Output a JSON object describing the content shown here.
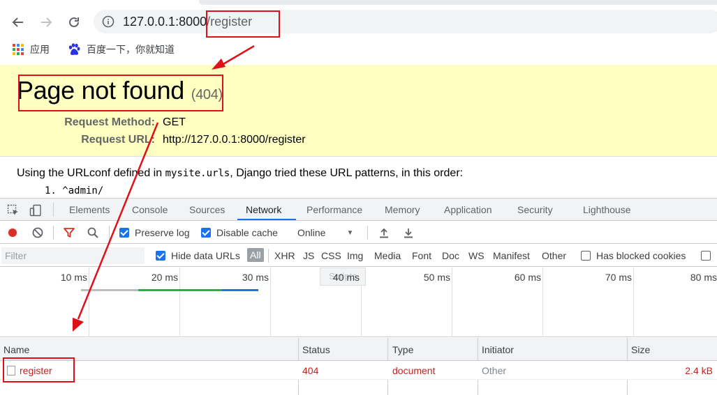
{
  "browser": {
    "url_host": "127.0.0.1:8000",
    "url_path": "/register",
    "bookmarks": [
      {
        "label": "应用",
        "icon": "apps-grid-icon"
      },
      {
        "label": "百度一下，你就知道",
        "icon": "baidu-paw-icon"
      }
    ]
  },
  "page": {
    "title": "Page not found",
    "status_code": "(404)",
    "request_method_label": "Request Method:",
    "request_method": "GET",
    "request_url_label": "Request URL:",
    "request_url": "http://127.0.0.1:8000/register",
    "info_before": "Using the URLconf defined in ",
    "info_module": "mysite.urls",
    "info_after": ", Django tried these URL patterns, in this order:",
    "patterns": [
      "1. ^admin/"
    ]
  },
  "devtools": {
    "tabs": [
      "Elements",
      "Console",
      "Sources",
      "Network",
      "Performance",
      "Memory",
      "Application",
      "Security",
      "Lighthouse"
    ],
    "active_tab": "Network",
    "controls": {
      "preserve_log": "Preserve log",
      "disable_cache": "Disable cache",
      "throttling": "Online"
    },
    "filter": {
      "placeholder": "Filter",
      "hide_data_urls": "Hide data URLs",
      "types": [
        "All",
        "XHR",
        "JS",
        "CSS",
        "Img",
        "Media",
        "Font",
        "Doc",
        "WS",
        "Manifest",
        "Other"
      ],
      "has_blocked_cookies": "Has blocked cookies"
    },
    "timeline": {
      "ticks": [
        "10 ms",
        "20 ms",
        "30 ms",
        "40 ms",
        "50 ms",
        "60 ms",
        "70 ms",
        "80 ms"
      ],
      "tooltip": "Scripts"
    },
    "table": {
      "columns": [
        "Name",
        "Status",
        "Type",
        "Initiator",
        "Size"
      ],
      "rows": [
        {
          "name": "register",
          "status": "404",
          "type": "document",
          "initiator": "Other",
          "size": "2.4 kB"
        }
      ]
    }
  },
  "colors": {
    "annotation": "#e0101a",
    "summary_bg": "#ffffc2",
    "error_text": "#c5221f",
    "accent": "#1a73e8"
  }
}
